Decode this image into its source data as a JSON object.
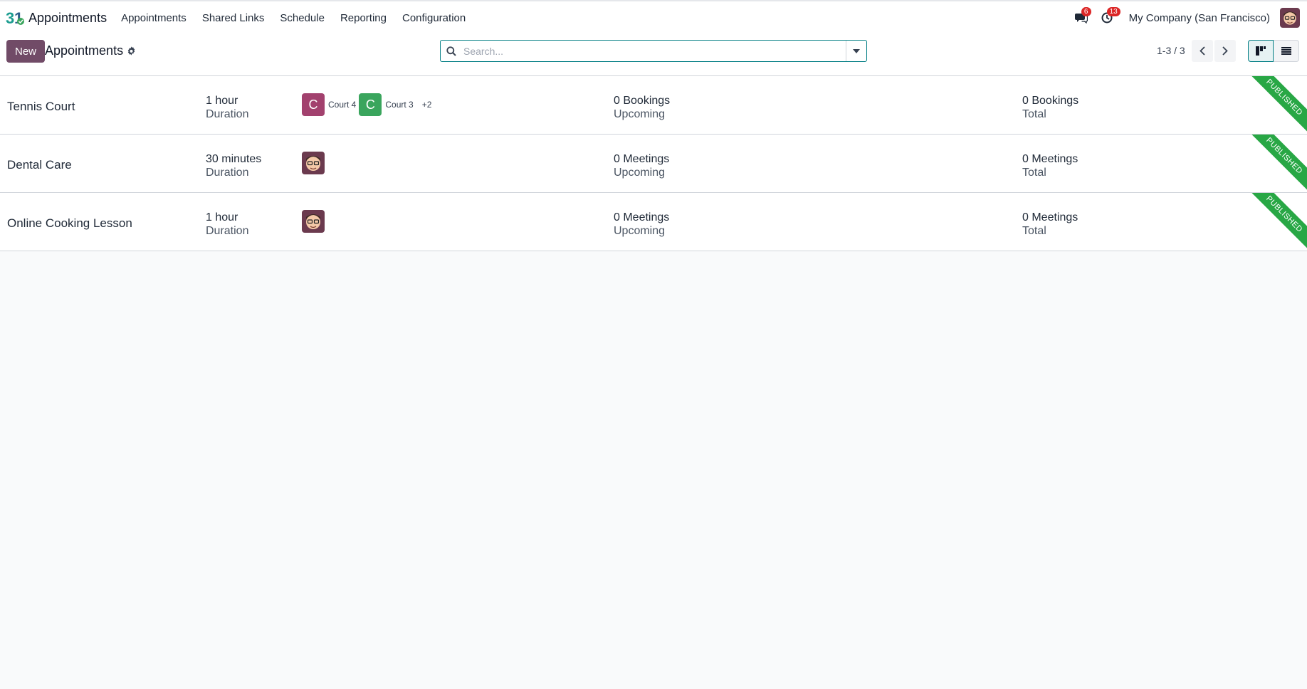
{
  "navbar": {
    "app_name": "Appointments",
    "menu": [
      "Appointments",
      "Shared Links",
      "Schedule",
      "Reporting",
      "Configuration"
    ],
    "messages_count": "6",
    "activities_count": "13",
    "company": "My Company (San Francisco)"
  },
  "control": {
    "new_label": "New",
    "title": "Appointments",
    "search_placeholder": "Search...",
    "pager": "1-3 / 3"
  },
  "rows": [
    {
      "name": "Tennis Court",
      "duration": "1 hour",
      "duration_label": "Duration",
      "resources": [
        {
          "initial": "C",
          "label": "Court 4",
          "color": "#a2416e"
        },
        {
          "initial": "C",
          "label": "Court 3",
          "color": "#3aa55d"
        }
      ],
      "more": "+2",
      "upcoming": "0 Bookings",
      "upcoming_label": "Upcoming",
      "total": "0 Bookings",
      "total_label": "Total",
      "ribbon": "PUBLISHED"
    },
    {
      "name": "Dental Care",
      "duration": "30 minutes",
      "duration_label": "Duration",
      "upcoming": "0 Meetings",
      "upcoming_label": "Upcoming",
      "total": "0 Meetings",
      "total_label": "Total",
      "ribbon": "PUBLISHED"
    },
    {
      "name": "Online Cooking Lesson",
      "duration": "1 hour",
      "duration_label": "Duration",
      "upcoming": "0 Meetings",
      "upcoming_label": "Upcoming",
      "total": "0 Meetings",
      "total_label": "Total",
      "ribbon": "PUBLISHED"
    }
  ],
  "colors": {
    "brand": "#714b67",
    "accent": "#017e84",
    "ribbon": "#28a745",
    "badge": "#dc2626"
  }
}
